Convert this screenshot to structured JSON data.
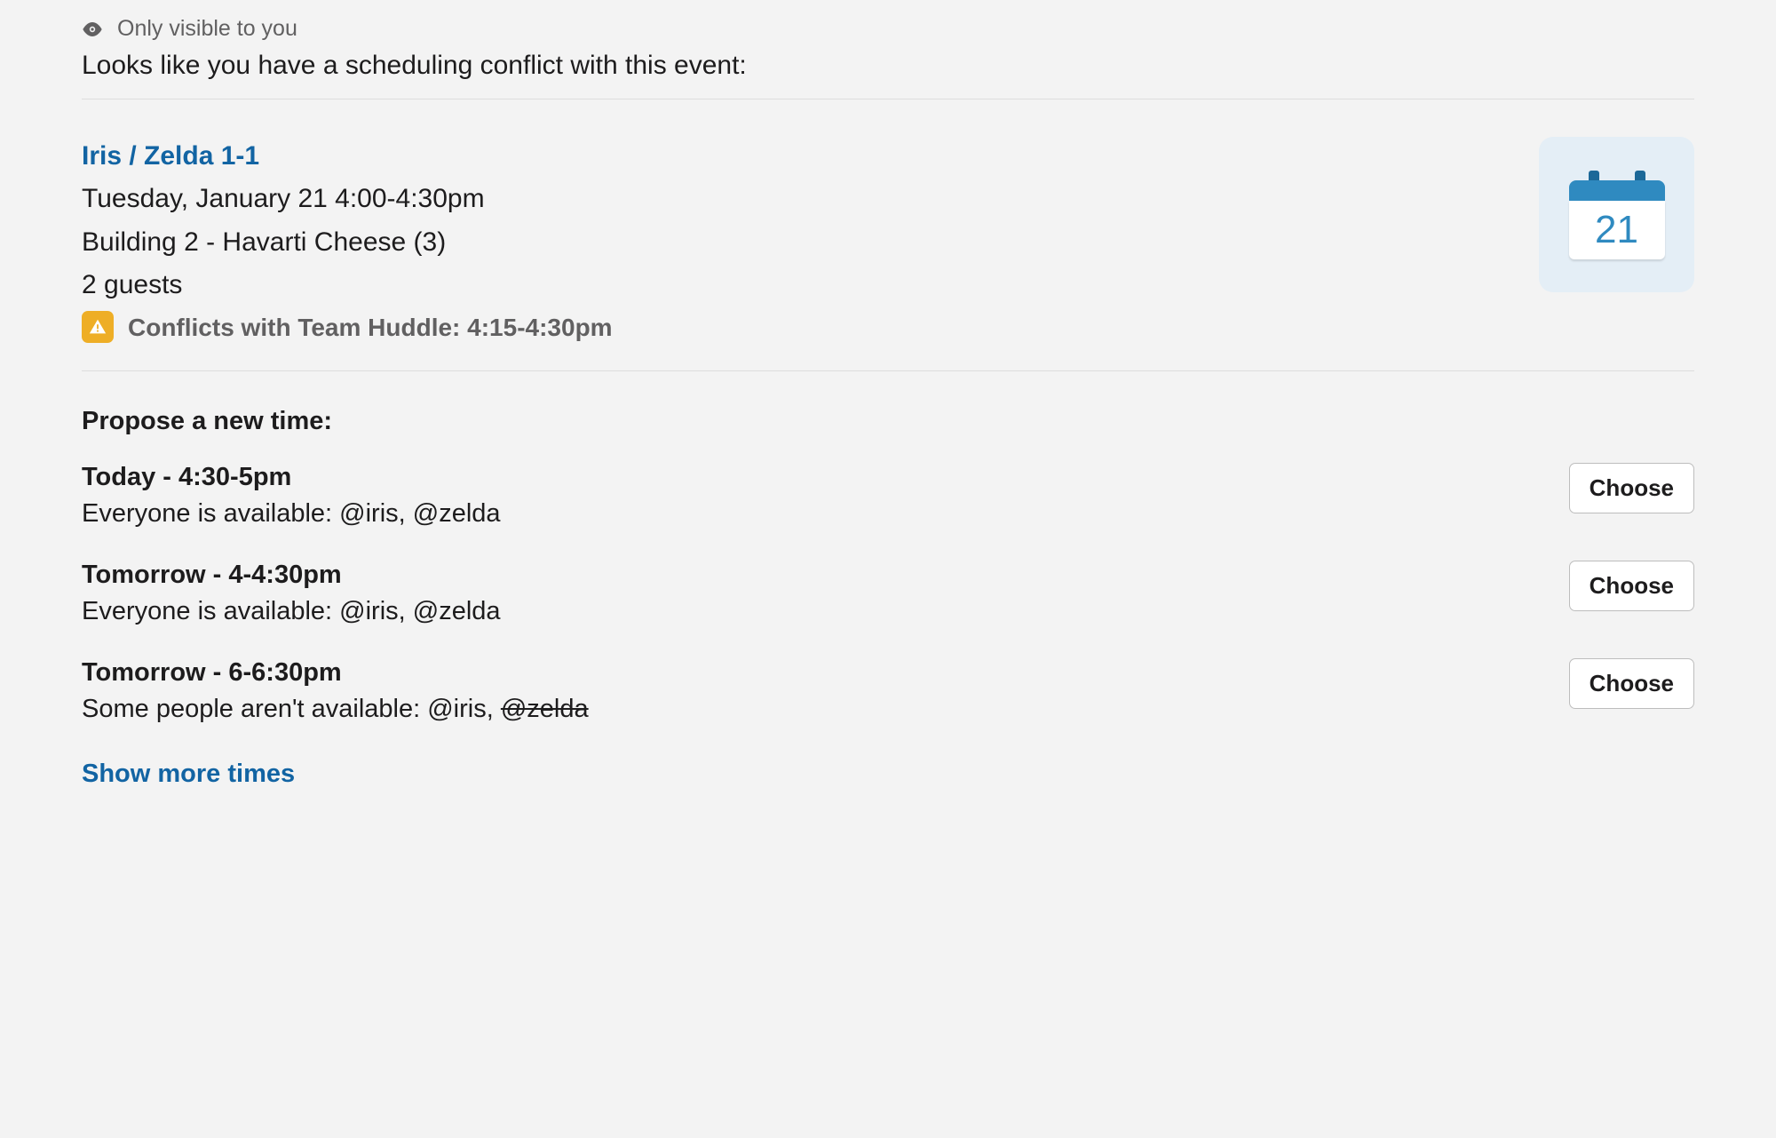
{
  "ephemeral_label": "Only visible to you",
  "intro": "Looks like you have a scheduling conflict with this event:",
  "event": {
    "title": "Iris / Zelda 1-1",
    "datetime": "Tuesday, January 21 4:00-4:30pm",
    "location": "Building 2 - Havarti Cheese (3)",
    "guests": "2 guests",
    "calendar_day": "21",
    "conflict_text": "Conflicts with Team Huddle: 4:15-4:30pm"
  },
  "propose_label": "Propose a new time:",
  "options": [
    {
      "title": "Today - 4:30-5pm",
      "availability_prefix": "Everyone is available: ",
      "people": [
        {
          "handle": "@iris",
          "available": true
        },
        {
          "handle": "@zelda",
          "available": true
        }
      ],
      "button": "Choose"
    },
    {
      "title": "Tomorrow - 4-4:30pm",
      "availability_prefix": "Everyone is available: ",
      "people": [
        {
          "handle": "@iris",
          "available": true
        },
        {
          "handle": "@zelda",
          "available": true
        }
      ],
      "button": "Choose"
    },
    {
      "title": "Tomorrow - 6-6:30pm",
      "availability_prefix": "Some people aren't available: ",
      "people": [
        {
          "handle": "@iris",
          "available": true
        },
        {
          "handle": "@zelda",
          "available": false
        }
      ],
      "button": "Choose"
    }
  ],
  "show_more": "Show more times"
}
